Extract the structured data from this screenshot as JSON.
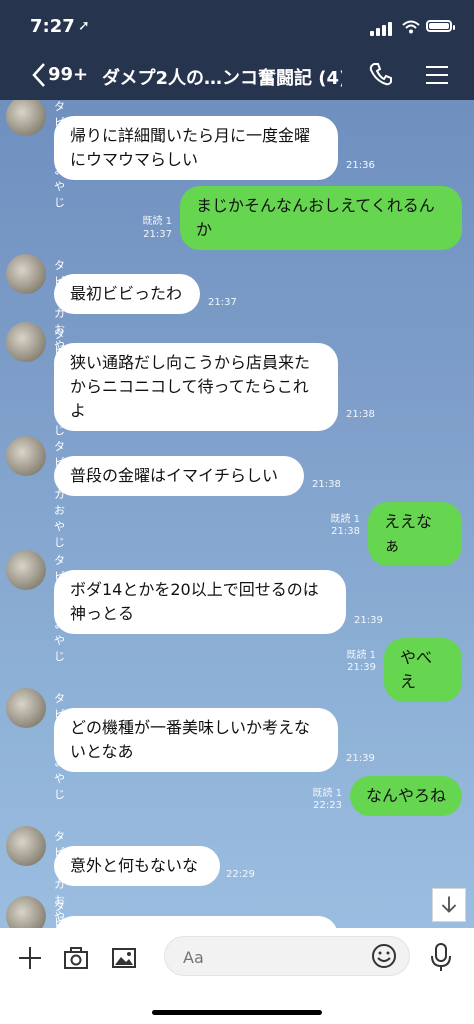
{
  "status": {
    "time": "7:27"
  },
  "header": {
    "back_count": "99+",
    "title": "ダメプ2人の…ンコ奮闘記 (4)"
  },
  "messages": [
    {
      "side": "left",
      "name": "タピオカおやじ",
      "text": "帰りに詳細聞いたら月に一度金曜にウマウマらしい",
      "time": "21:36"
    },
    {
      "side": "right",
      "read": "既読 1",
      "text": "まじかそんなんおしえてくれるんか",
      "time": "21:37"
    },
    {
      "side": "left",
      "name": "タピオカおやじ",
      "text": "最初ビビったわ",
      "time": "21:37"
    },
    {
      "side": "left",
      "name": "タピオカおやじ",
      "text": "狭い通路だし向こうから店員来たからニコニコして待ってたらこれよ",
      "time": "21:38"
    },
    {
      "side": "left",
      "name": "タピオカおやじ",
      "text": "普段の金曜はイマイチらしい",
      "time": "21:38"
    },
    {
      "side": "right",
      "read": "既読 1",
      "text": "ええなぁ",
      "time": "21:38"
    },
    {
      "side": "left",
      "name": "タピオカおやじ",
      "text": "ボダ14とかを20以上で回せるのは神っとる",
      "time": "21:39"
    },
    {
      "side": "right",
      "read": "既読 1",
      "text": "やべえ",
      "time": "21:39"
    },
    {
      "side": "left",
      "name": "タピオカおやじ",
      "text": "どの機種が一番美味しいか考えないとなあ",
      "time": "21:39"
    },
    {
      "side": "right",
      "read": "既読 1",
      "text": "なんやろね",
      "time": "22:23"
    },
    {
      "side": "left",
      "name": "タピオカおやじ",
      "text": "意外と何もないな",
      "time": "22:29"
    },
    {
      "side": "left",
      "name": "タピオカおやじ",
      "text": "",
      "time": ""
    }
  ],
  "input": {
    "placeholder": "Aa"
  },
  "icons": {
    "back": "chevron-left-icon",
    "phone": "phone-icon",
    "menu": "menu-icon",
    "plus": "plus-icon",
    "camera": "camera-icon",
    "image": "image-icon",
    "smile": "emoji-icon",
    "mic": "microphone-icon",
    "scroll": "arrow-down-icon"
  },
  "colors": {
    "header": "#26344d",
    "me_bubble": "#66d54f",
    "other_bubble": "#ffffff"
  }
}
